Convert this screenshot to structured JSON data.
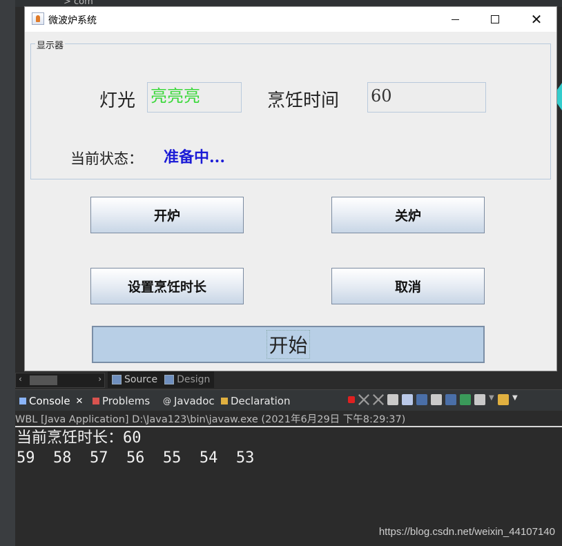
{
  "ide": {
    "top_crumb": "> com",
    "editor_tabs": [
      {
        "label": "Source",
        "icon": "source-icon"
      },
      {
        "label": "Design",
        "icon": "design-icon"
      }
    ],
    "console_tabs": [
      {
        "label": "Console",
        "icon": "console-icon",
        "active": true
      },
      {
        "label": "Problems",
        "icon": "problems-icon"
      },
      {
        "label": "Javadoc",
        "icon": "javadoc-icon"
      },
      {
        "label": "Declaration",
        "icon": "declaration-icon"
      }
    ],
    "console_close": "✕",
    "console_path": "WBL [Java Application] D:\\Java123\\bin\\javaw.exe  (2021年6月29日 下午8:29:37)",
    "console_lines": [
      "当前烹饪时长：60",
      "59  58  57  56  55  54  53"
    ],
    "watermark": "https://blog.csdn.net/weixin_44107140",
    "colors": {
      "terminate": "#e02020",
      "accent": "#6f8fbf"
    }
  },
  "window": {
    "title": "微波炉系统",
    "group_title": "显示器",
    "light_label": "灯光",
    "light_value": "亮亮亮",
    "time_label": "烹饪时间",
    "time_value": "60",
    "state_label": "当前状态：",
    "state_value": "准备中...",
    "buttons": {
      "open": "开炉",
      "close": "关炉",
      "set_time": "设置烹饪时长",
      "cancel": "取消",
      "start": "开始"
    },
    "colors": {
      "light_text": "#3ad83a",
      "state_text": "#1b1bd6",
      "start_bg": "#b8cfe6"
    }
  }
}
